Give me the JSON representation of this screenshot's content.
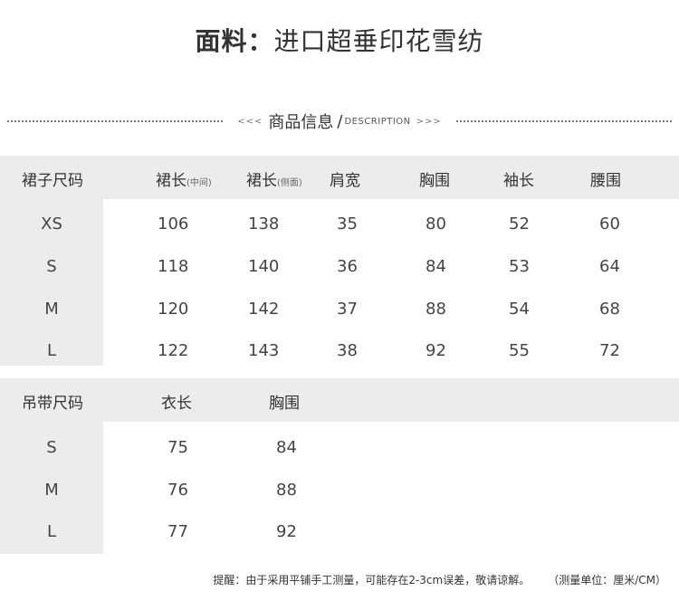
{
  "fabric": {
    "label": "面料：",
    "value": "进口超垂印花雪纺"
  },
  "section": {
    "arrows_left": "<<<",
    "title": "商品信息",
    "subtitle": "DESCRIPTION",
    "arrows_right": ">>>"
  },
  "skirt_table": {
    "headers": [
      {
        "main": "裙子尺码",
        "note": ""
      },
      {
        "main": "裙长",
        "note": "(中间)"
      },
      {
        "main": "裙长",
        "note": "(侧面)"
      },
      {
        "main": "肩宽",
        "note": ""
      },
      {
        "main": "胸围",
        "note": ""
      },
      {
        "main": "袖长",
        "note": ""
      },
      {
        "main": "腰围",
        "note": ""
      }
    ],
    "rows": [
      {
        "size": "XS",
        "values": [
          "106",
          "138",
          "35",
          "80",
          "52",
          "60"
        ]
      },
      {
        "size": "S",
        "values": [
          "118",
          "140",
          "36",
          "84",
          "53",
          "64"
        ]
      },
      {
        "size": "M",
        "values": [
          "120",
          "142",
          "37",
          "88",
          "54",
          "68"
        ]
      },
      {
        "size": "L",
        "values": [
          "122",
          "143",
          "38",
          "92",
          "55",
          "72"
        ]
      }
    ]
  },
  "strap_table": {
    "headers": [
      {
        "main": "吊带尺码",
        "note": ""
      },
      {
        "main": "衣长",
        "note": ""
      },
      {
        "main": "胸围",
        "note": ""
      }
    ],
    "rows": [
      {
        "size": "S",
        "values": [
          "75",
          "84"
        ]
      },
      {
        "size": "M",
        "values": [
          "76",
          "88"
        ]
      },
      {
        "size": "L",
        "values": [
          "77",
          "92"
        ]
      }
    ]
  },
  "footer": {
    "note": "提醒：由于采用平铺手工测量，可能存在2-3cm误差，敬请谅解。",
    "unit": "（测量单位：厘米/CM）"
  }
}
